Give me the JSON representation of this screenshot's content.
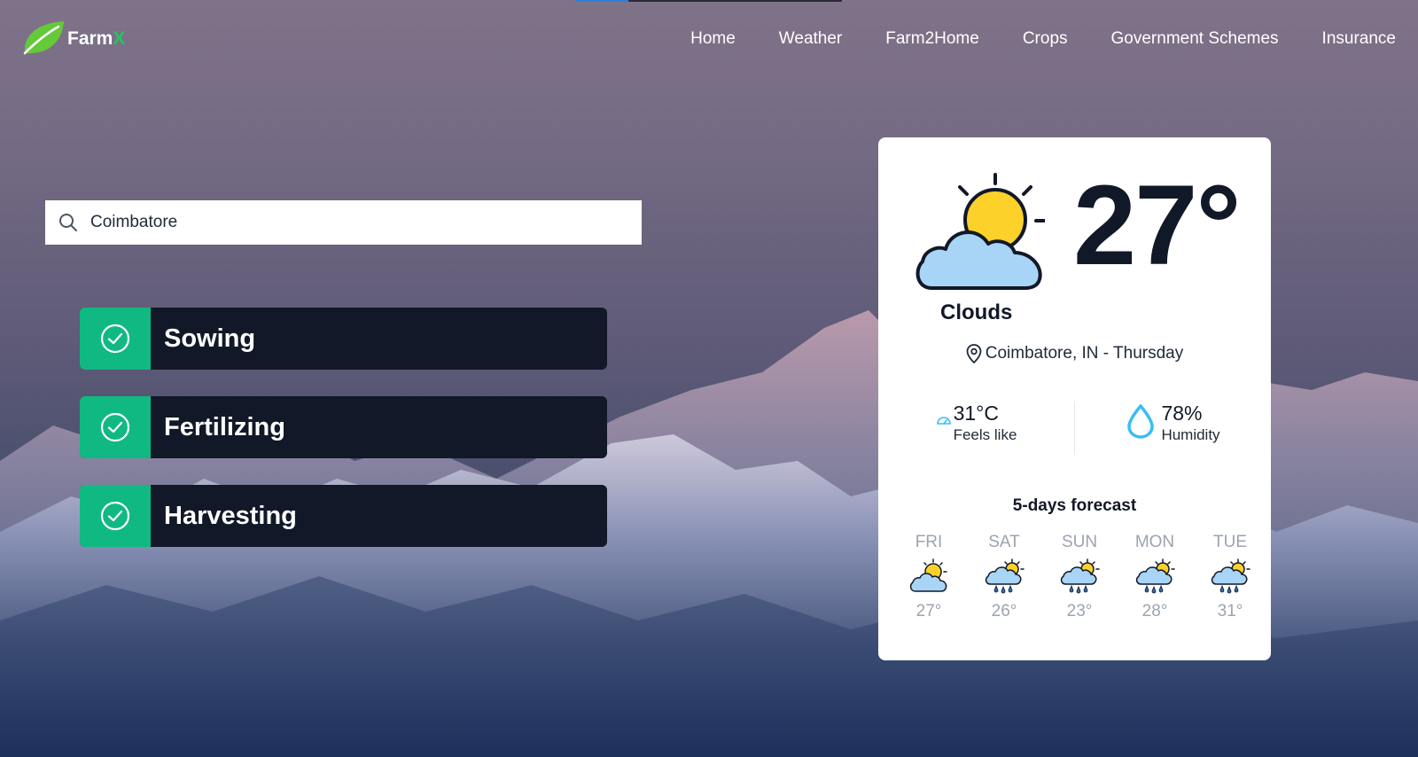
{
  "app": {
    "logo_text_main": "Farm",
    "logo_text_accent": "X",
    "brand_color": "#22c55e"
  },
  "nav": {
    "items": [
      "Home",
      "Weather",
      "Farm2Home",
      "Crops",
      "Government Schemes",
      "Insurance"
    ]
  },
  "top_progress": {
    "fraction": 0.2
  },
  "search": {
    "icon": "search-icon",
    "value": "Coimbatore"
  },
  "steps": [
    {
      "label": "Sowing",
      "icon": "check-circle-icon"
    },
    {
      "label": "Fertilizing",
      "icon": "check-circle-icon"
    },
    {
      "label": "Harvesting",
      "icon": "check-circle-icon"
    }
  ],
  "weather": {
    "temperature": "27°",
    "condition": "Clouds",
    "condition_icon": "partly-cloudy-icon",
    "location": "Coimbatore, IN - Thursday",
    "feels_like": {
      "value": "31°C",
      "label": "Feels like",
      "icon": "gauge-icon"
    },
    "humidity": {
      "value": "78%",
      "label": "Humidity",
      "icon": "droplet-icon"
    },
    "forecast_title": "5-days forecast",
    "forecast": [
      {
        "day": "FRI",
        "temp": "27°",
        "icon": "partly-cloudy-icon"
      },
      {
        "day": "SAT",
        "temp": "26°",
        "icon": "rain-sun-icon"
      },
      {
        "day": "SUN",
        "temp": "23°",
        "icon": "rain-sun-icon"
      },
      {
        "day": "MON",
        "temp": "28°",
        "icon": "rain-sun-icon"
      },
      {
        "day": "TUE",
        "temp": "31°",
        "icon": "rain-sun-icon"
      }
    ]
  },
  "colors": {
    "step_check_bg": "#10b981",
    "step_bg": "#111827",
    "sun": "#facc15",
    "cloud": "#a8d4f5"
  }
}
